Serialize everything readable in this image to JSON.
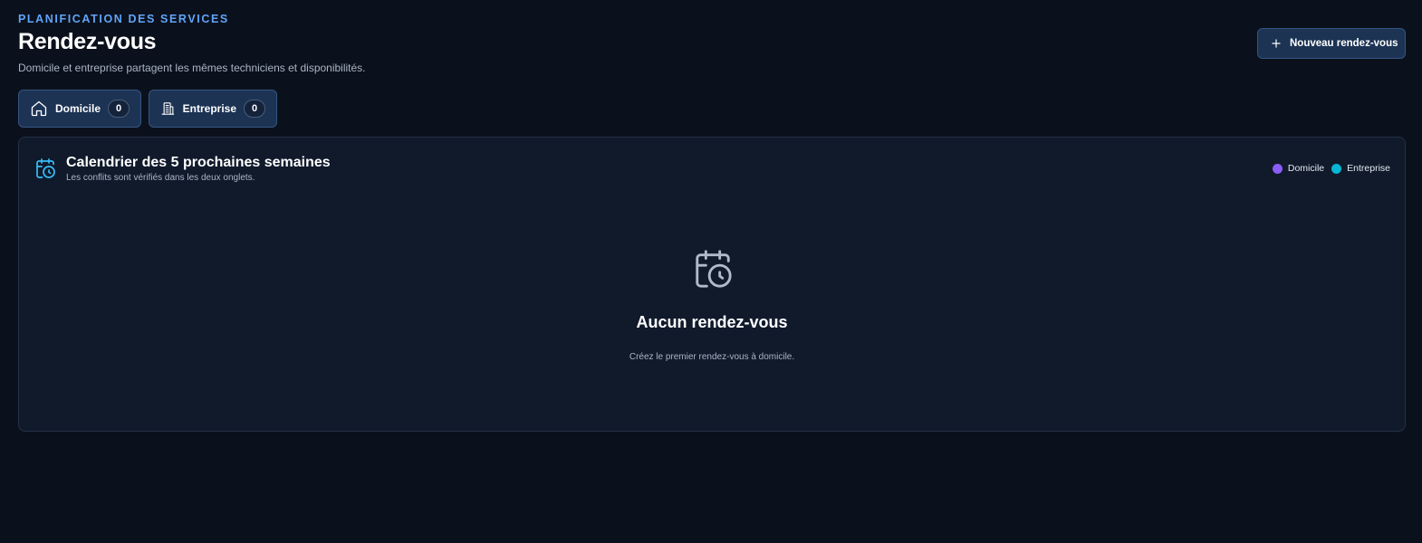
{
  "header": {
    "eyebrow": "PLANIFICATION DES SERVICES",
    "title": "Rendez-vous",
    "subtitle": "Domicile et entreprise partagent les mêmes techniciens et disponibilités."
  },
  "actions": {
    "new_appointment_label": "Nouveau rendez-vous",
    "new_appointment_icon": "plus-icon"
  },
  "tabs": [
    {
      "label": "Domicile",
      "count": "0",
      "icon": "home-icon"
    },
    {
      "label": "Entreprise",
      "count": "0",
      "icon": "building-icon"
    }
  ],
  "calendar": {
    "title": "Calendrier des 5 prochaines semaines",
    "subtitle": "Les conflits sont vérifiés dans les deux onglets.",
    "icon": "calendar-clock-icon",
    "legend": [
      {
        "label": "Domicile",
        "color": "#8b5cf6"
      },
      {
        "label": "Entreprise",
        "color": "#06b6d4"
      }
    ],
    "empty": {
      "title": "Aucun rendez-vous",
      "message": "Créez le premier rendez-vous à domicile.",
      "icon": "calendar-clock-icon"
    }
  },
  "colors": {
    "background": "#0b111c",
    "accent": "#60a5fa",
    "icon_accent": "#38bdf8",
    "button_bg": "#1c3354"
  }
}
